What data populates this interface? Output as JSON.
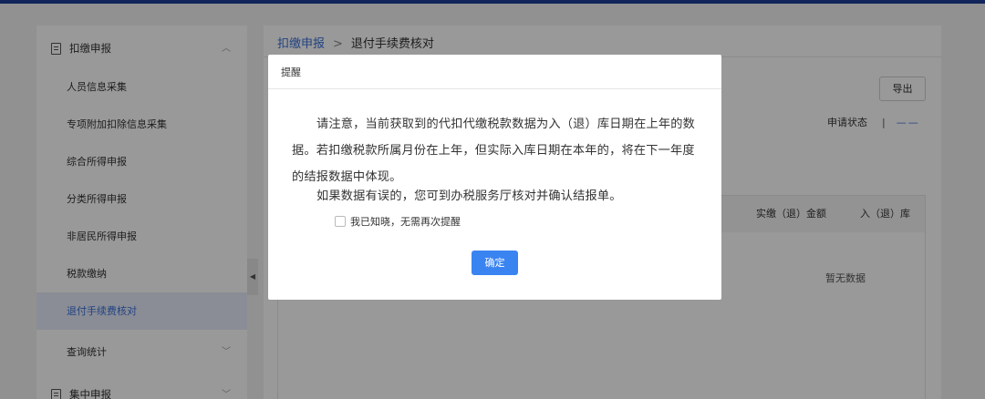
{
  "sidebar": {
    "group_label": "扣缴申报",
    "items": [
      {
        "label": "人员信息采集"
      },
      {
        "label": "专项附加扣除信息采集"
      },
      {
        "label": "综合所得申报"
      },
      {
        "label": "分类所得申报"
      },
      {
        "label": "非居民所得申报"
      },
      {
        "label": "税款缴纳"
      },
      {
        "label": "退付手续费核对"
      },
      {
        "label": "查询统计"
      }
    ],
    "group2_label": "集中申报",
    "active_item": "退付手续费核对"
  },
  "breadcrumb": {
    "parent": "扣缴申报",
    "separator": ">",
    "current": "退付手续费核对"
  },
  "toolbar": {
    "export_label": "导出",
    "status_label": "申请状态",
    "status_sep": "|",
    "status_value": "——"
  },
  "table": {
    "headers": [
      "实缴（退）金额",
      "入（退）库"
    ],
    "empty_text": "暂无数据"
  },
  "dialog": {
    "title": "提醒",
    "message_1": "请注意，当前获取到的代扣代缴税款数据为入（退）库日期在上年的数据。若扣缴税款所属月份在上年，但实际入库日期在本年的，将在下一年度的结报数据中体现。",
    "message_2": "如果数据有误的，您可到办税服务厅核对并确认结报单。",
    "checkbox_label": "我已知晓，无需再次提醒",
    "checkbox_checked": false,
    "confirm_label": "确定"
  },
  "colors": {
    "accent": "#3a6fd8",
    "button_primary": "#3a84f2",
    "top_bar": "#1d3f96"
  }
}
